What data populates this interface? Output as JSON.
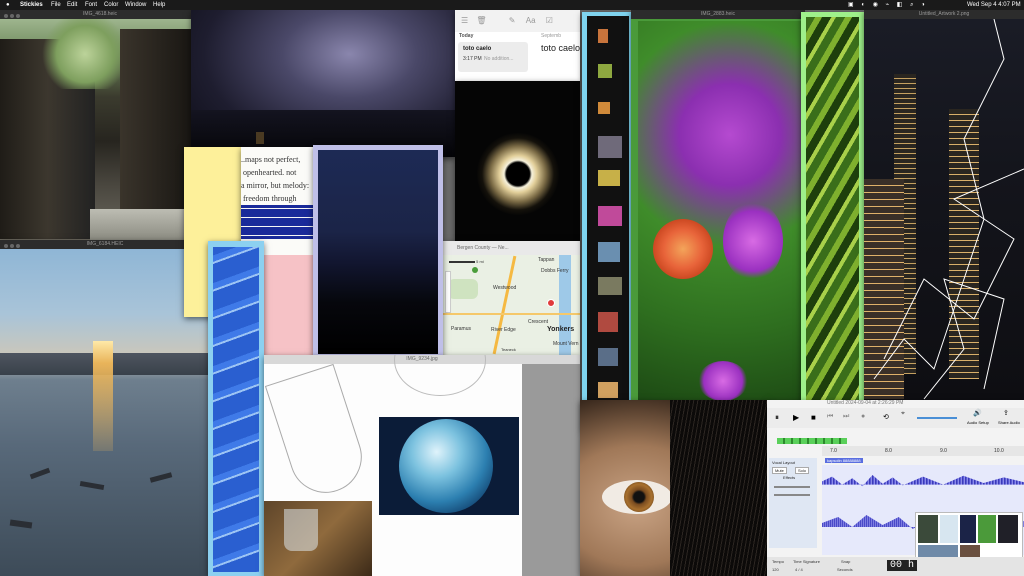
{
  "menubar": {
    "app": "Stickies",
    "menus": [
      "File",
      "Edit",
      "Font",
      "Color",
      "Window",
      "Help"
    ],
    "datetime": "Wed Sep 4  4:07 PM"
  },
  "windows": {
    "gorge": {
      "title": "IMG_4618.heic"
    },
    "river": {
      "title": "IMG_6184.HEIC"
    },
    "flowers": {
      "title": "IMG_2883.heic"
    },
    "artwork": {
      "title": "Untitled_Artwork 2.png"
    },
    "sketch": {
      "title": "IMG_9234.jpg"
    }
  },
  "notes_app": {
    "section": "Today",
    "note_title": "toto caelo",
    "note_time": "3:17 PM",
    "note_preview": "No addition...",
    "header_right": "Septemb",
    "editor_text": "toto caelo"
  },
  "maps": {
    "title": "Bergen County — Ne...",
    "scale": "5 mi",
    "places": [
      "Tappan",
      "Dobbs Ferry",
      "Westwood",
      "Paramus",
      "River Edge",
      "Crescent",
      "Yonkers",
      "Teaneck",
      "Mount Vern"
    ]
  },
  "poem": {
    "lines": [
      "...maps not perfect,",
      "openhearted. not",
      "a mirror, but melody:",
      "freedom through"
    ]
  },
  "audio_app": {
    "title": "Untitled 2024-09-04 at 2:26:29 PM",
    "audio_setup": "Audio Setup",
    "share_audio": "Share Audio",
    "track_name": "Vocal Layout",
    "mute": "Mute",
    "solo": "Solo",
    "effects": "Effects",
    "clip_label": "kapsolin 88888888",
    "ruler": [
      "7.0",
      "8.0",
      "9.0",
      "10.0"
    ],
    "timecode": "00 h",
    "tempo_label": "Tempo",
    "tempo": "120",
    "sig_label": "Time Signature",
    "sig": "4 / 4",
    "snap_label": "Snap",
    "snap": "Seconds"
  }
}
